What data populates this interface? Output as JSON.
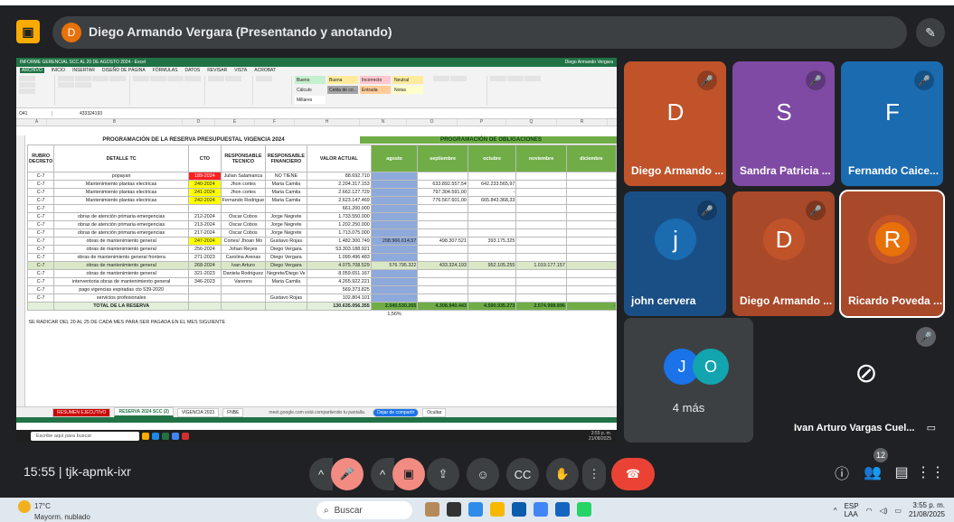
{
  "meet": {
    "presenter_initial": "D",
    "presenter_title": "Diego Armando Vergara (Presentando y anotando)",
    "time": "15:55",
    "code": "tjk-apmk-ixr",
    "people_count": "12"
  },
  "excel": {
    "title": "INFORME GERENCIAL SCC AL 20 DE AGOSTO 2024 - Excel",
    "user": "Diego Armando Vergara",
    "tabs": [
      "ARCHIVO",
      "INICIO",
      "INSERTAR",
      "DISEÑO DE PÁGINA",
      "FÓRMULAS",
      "DATOS",
      "REVISAR",
      "VISTA",
      "ACROBAT"
    ],
    "styles": [
      "Bueno",
      "Buena",
      "Incorrecto",
      "Neutral",
      "Cálculo",
      "Celda de co...",
      "Entrada",
      "Notas",
      "Millares"
    ],
    "namebox": "O41",
    "formula": "433324193",
    "title_left": "PROGRAMACIÓN DE LA RESERVA PRESUPUESTAL VIGENCIA 2024",
    "title_right": "PROGRAMACIÓN DE OBLIGACIONES",
    "cols": [
      "A",
      "B",
      "D",
      "E",
      "F",
      "H",
      "N",
      "O",
      "P",
      "Q",
      "R"
    ],
    "headers": [
      "RUBRO DECRETO",
      "DETALLE TC",
      "CTO",
      "RESPONSABLE TECNICO",
      "RESPONSABLE FINANCIERO",
      "VALOR ACTUAL",
      "agosto",
      "septiembre",
      "octubre",
      "noviembre",
      "diciembre"
    ],
    "rows": [
      {
        "n": "20",
        "rub": "C-7",
        "det": "popayan",
        "cto": "189-2024",
        "rt": "Julian Salamanca",
        "rf": "NO TIENE",
        "val": "88.692.710",
        "ago": "",
        "sep": "",
        "oct": "",
        "nov": "",
        "dic": "",
        "k": "red"
      },
      {
        "n": "31",
        "rub": "C-7",
        "det": "Mantenimiento plantas electricas",
        "cto": "240-2024",
        "rt": "Jhon cortes",
        "rf": "Maria Camila",
        "val": "2.204.317.153",
        "ago": "",
        "sep": "633.892.557,54",
        "oct": "642.233.565,97",
        "nov": "",
        "dic": "",
        "k": "yel"
      },
      {
        "n": "32",
        "rub": "C-7",
        "det": "Mantenimiento plantas electricas",
        "cto": "241-2024",
        "rt": "Jhon cortes",
        "rf": "Maria Camila",
        "val": "2.662.127.729",
        "ago": "",
        "sep": "797.304.591,00",
        "oct": "-",
        "nov": "",
        "dic": "",
        "k": "yel"
      },
      {
        "n": "33",
        "rub": "C-7",
        "det": "Mantenimiento plantas electricas",
        "cto": "242-2024",
        "rt": "Fernando Rodrigue",
        "rf": "Maria Camila",
        "val": "2.623.147.469",
        "ago": "",
        "sep": "776.567.601,00",
        "oct": "665.843.368,33",
        "nov": "",
        "dic": "",
        "k": "yel"
      },
      {
        "n": "34",
        "rub": "C-7",
        "det": "",
        "cto": "",
        "rt": "",
        "rf": "",
        "val": "661.200.000",
        "ago": "",
        "sep": "",
        "oct": "",
        "nov": "",
        "dic": "",
        "k": ""
      },
      {
        "n": "35",
        "rub": "C-7",
        "det": "obras de atención primaria emergencias",
        "cto": "212-2024",
        "rt": "Oscar Cobos",
        "rf": "Jorge Negrete",
        "val": "1.733.550.000",
        "ago": "",
        "sep": "",
        "oct": "",
        "nov": "",
        "dic": "",
        "k": ""
      },
      {
        "n": "36",
        "rub": "C-7",
        "det": "obras de atención primaria emergencias",
        "cto": "213-2024",
        "rt": "Oscar Cobos",
        "rf": "Jorge Negrete",
        "val": "1.202.250.000",
        "ago": "",
        "sep": "",
        "oct": "",
        "nov": "",
        "dic": "",
        "k": ""
      },
      {
        "n": "37",
        "rub": "C-7",
        "det": "obras de atención primaria emergencias",
        "cto": "217-2024",
        "rt": "Oscar Cobos",
        "rf": "Jorge Negrete",
        "val": "1.713.075.000",
        "ago": "",
        "sep": "",
        "oct": "",
        "nov": "",
        "dic": "",
        "k": ""
      },
      {
        "n": "38",
        "rub": "C-7",
        "det": "obras de mantenimiento general",
        "cto": "247-2024",
        "rt": "Cortes/ Jhoan Mo",
        "rf": "Gustavo Rojas",
        "val": "1.482.300.749",
        "ago": "298.966.614,57",
        "sep": "498.307.521",
        "oct": "393.175.325",
        "nov": "",
        "dic": "",
        "k": "yel"
      },
      {
        "n": "39",
        "rub": "C-7",
        "det": "obras de mantenimiento general",
        "cto": "256-2024",
        "rt": "Johan Reyes",
        "rf": "Diego Vergara",
        "val": "53.303.188.921",
        "ago": "",
        "sep": "",
        "oct": "",
        "nov": "",
        "dic": "",
        "k": ""
      },
      {
        "n": "40",
        "rub": "C-7",
        "det": "obras de mantenimiento general frontera",
        "cto": "271-2023",
        "rt": "Carolina Arenas",
        "rf": "Diego Vergara",
        "val": "1.099.496.483",
        "ago": "",
        "sep": "",
        "oct": "",
        "nov": "",
        "dic": "",
        "k": ""
      },
      {
        "n": "41",
        "rub": "C-7",
        "det": "obras de mantenimiento general",
        "cto": "268-2024",
        "rt": "Ivan Arturo",
        "rf": "Diego Vergara",
        "val": "4.075.708.529",
        "ago": "576.795.322",
        "sep": "433.324.193",
        "oct": "952.105.255",
        "nov": "1.019.177.157",
        "dic": "",
        "k": "yel",
        "sel": true
      },
      {
        "n": "42",
        "rub": "C-7",
        "det": "obras de mantenimiento general",
        "cto": "321-2023",
        "rt": "Daniela Rodriguez",
        "rf": "Negrete/Diego Ve",
        "val": "8.059.651.167",
        "ago": "",
        "sep": "",
        "oct": "",
        "nov": "",
        "dic": "",
        "k": ""
      },
      {
        "n": "43",
        "rub": "C-7",
        "det": "interventoria obras de mantenimiento general",
        "cto": "346-2023",
        "rt": "Varenns",
        "rf": "Maria Camila",
        "val": "4.265.922.221",
        "ago": "",
        "sep": "",
        "oct": "",
        "nov": "",
        "dic": "",
        "k": ""
      },
      {
        "n": "44",
        "rub": "C-7",
        "det": "pago vigencias expiradas cto 539-2020",
        "cto": "",
        "rt": "",
        "rf": "",
        "val": "569.373.825",
        "ago": "",
        "sep": "",
        "oct": "",
        "nov": "",
        "dic": "",
        "k": ""
      },
      {
        "n": "45",
        "rub": "C-7",
        "det": "servicios profesionales",
        "cto": "",
        "rt": "",
        "rf": "Gustavo Rojas",
        "val": "102.804.101",
        "ago": "",
        "sep": "",
        "oct": "",
        "nov": "",
        "dic": "",
        "k": ""
      }
    ],
    "total": {
      "label": "TOTAL DE LA RESERVA",
      "val": "130.635.056.355",
      "ago": "2.040.530.265",
      "sep": "4.308.940.443",
      "oct": "4.590.935.273",
      "nov": "2.574.998.896",
      "dic": "-",
      "pct": "1,56%"
    },
    "note": "SE RADICAR DEL 20 AL 25 DE CADA MES PARA SER PAGADA EN EL MES SIGUIENTE",
    "sheets": [
      "RESUMEN EJECUTIVO",
      "RESERVA 2024 SCC (2)",
      "VIGENCIA 2023",
      "FNBE"
    ],
    "share_msg": "meet.google.com está compartiendo tu pantalla.",
    "stop_share": "Dejar de compartir",
    "hide": "Ocultar"
  },
  "inner_task": {
    "search": "Escribe aquí para buscar",
    "clock": "3:55 p. m.\n21/08/2025"
  },
  "tiles": [
    {
      "initial": "D",
      "name": "Diego Armando ...",
      "color": "#c0532a",
      "bg": "#c0532a",
      "muted": true
    },
    {
      "initial": "S",
      "name": "Sandra Patricia ...",
      "color": "#7e4aa3",
      "bg": "#7e4aa3",
      "muted": true
    },
    {
      "initial": "F",
      "name": "Fernando Caice...",
      "color": "#1a6bb0",
      "bg": "#1a6bb0",
      "muted": true
    },
    {
      "initial": "j",
      "name": "john cervera",
      "color": "#1a6bb0",
      "bg": "#1a4f86",
      "muted": true
    },
    {
      "initial": "D",
      "name": "Diego Armando ...",
      "color": "#c0532a",
      "bg": "#a8492a",
      "muted": true
    },
    {
      "initial": "R",
      "name": "Ricardo Poveda ...",
      "color": "#e8710a",
      "bg": "#a8492a",
      "muted": false
    }
  ],
  "more": {
    "a": "J",
    "b": "O",
    "label": "4 más"
  },
  "self": {
    "name": "Ivan Arturo Vargas Cuel..."
  },
  "windows": {
    "temp": "17°C",
    "weather": "Mayorm. nublado",
    "search": "Buscar",
    "lang": "ESP\nLAA",
    "time": "3:55 p. m.",
    "date": "21/08/2025"
  }
}
